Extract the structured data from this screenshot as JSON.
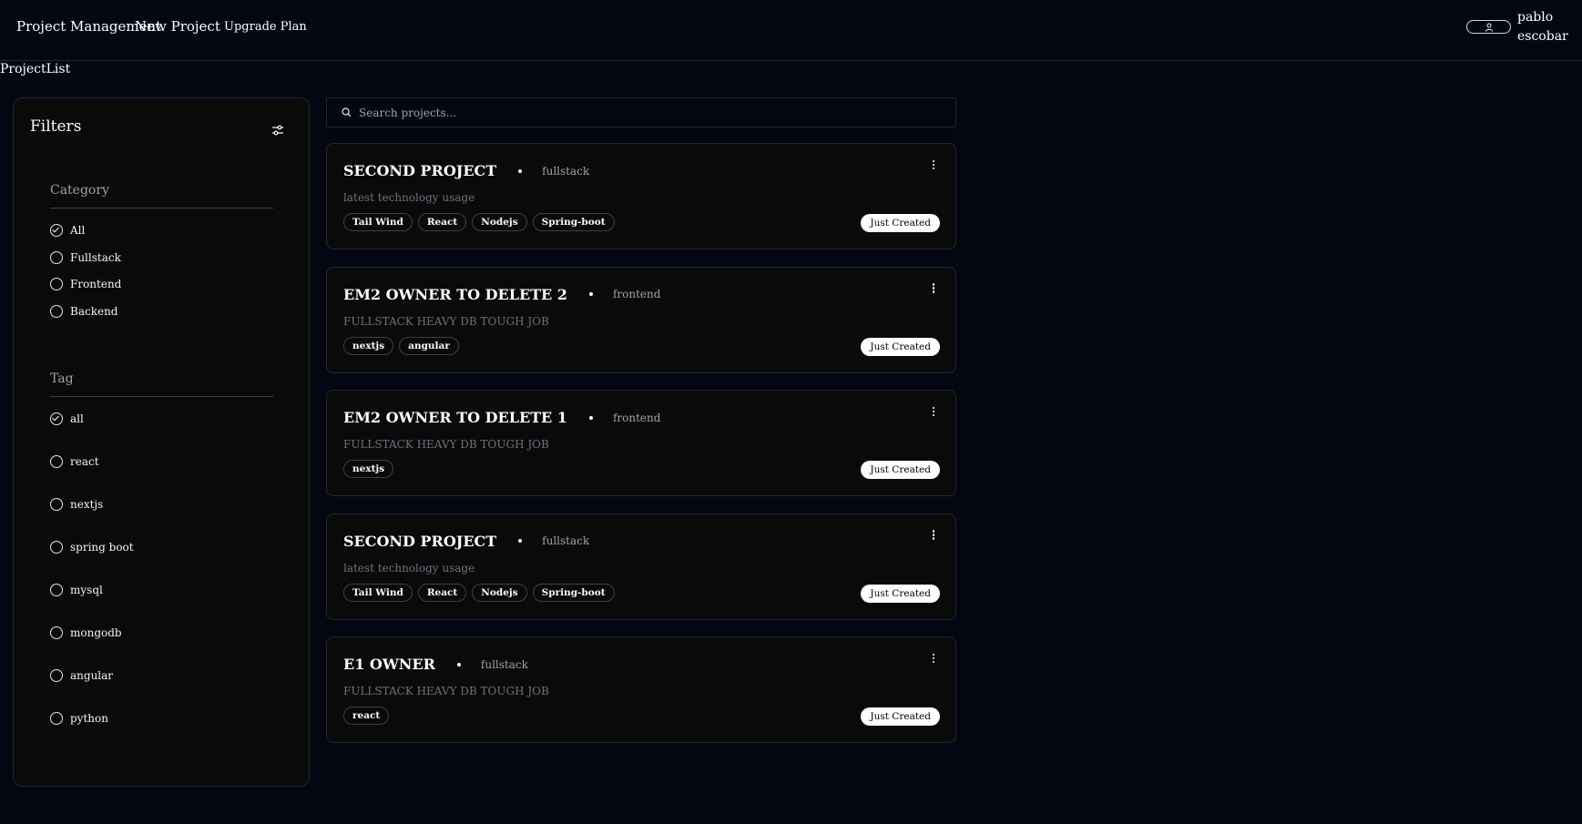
{
  "nav": {
    "brand": "Project Management",
    "new_project": "New Project",
    "upgrade": "Upgrade Plan",
    "user_name": "pablo escobar"
  },
  "breadcrumb": "ProjectList",
  "filters": {
    "title": "Filters",
    "category": {
      "title": "Category",
      "options": [
        "All",
        "Fullstack",
        "Frontend",
        "Backend"
      ],
      "selected": "All"
    },
    "tag": {
      "title": "Tag",
      "options": [
        "all",
        "react",
        "nextjs",
        "spring boot",
        "mysql",
        "mongodb",
        "angular",
        "python"
      ],
      "selected": "all"
    }
  },
  "search": {
    "placeholder": "Search projects..."
  },
  "projects": [
    {
      "title": "SECOND PROJECT",
      "category": "fullstack",
      "description": "latest technology usage",
      "tags": [
        "Tail Wind",
        "React",
        "Nodejs",
        "Spring-boot"
      ],
      "status": "Just Created"
    },
    {
      "title": "EM2 OWNER TO DELETE 2",
      "category": "frontend",
      "description": "FULLSTACK HEAVY DB TOUGH JOB",
      "tags": [
        "nextjs",
        "angular"
      ],
      "status": "Just Created"
    },
    {
      "title": "EM2 OWNER TO DELETE 1",
      "category": "frontend",
      "description": "FULLSTACK HEAVY DB TOUGH JOB",
      "tags": [
        "nextjs"
      ],
      "status": "Just Created"
    },
    {
      "title": "SECOND PROJECT",
      "category": "fullstack",
      "description": "latest technology usage",
      "tags": [
        "Tail Wind",
        "React",
        "Nodejs",
        "Spring-boot"
      ],
      "status": "Just Created"
    },
    {
      "title": "E1 OWNER",
      "category": "fullstack",
      "description": "FULLSTACK HEAVY DB TOUGH JOB",
      "tags": [
        "react"
      ],
      "status": "Just Created"
    }
  ]
}
